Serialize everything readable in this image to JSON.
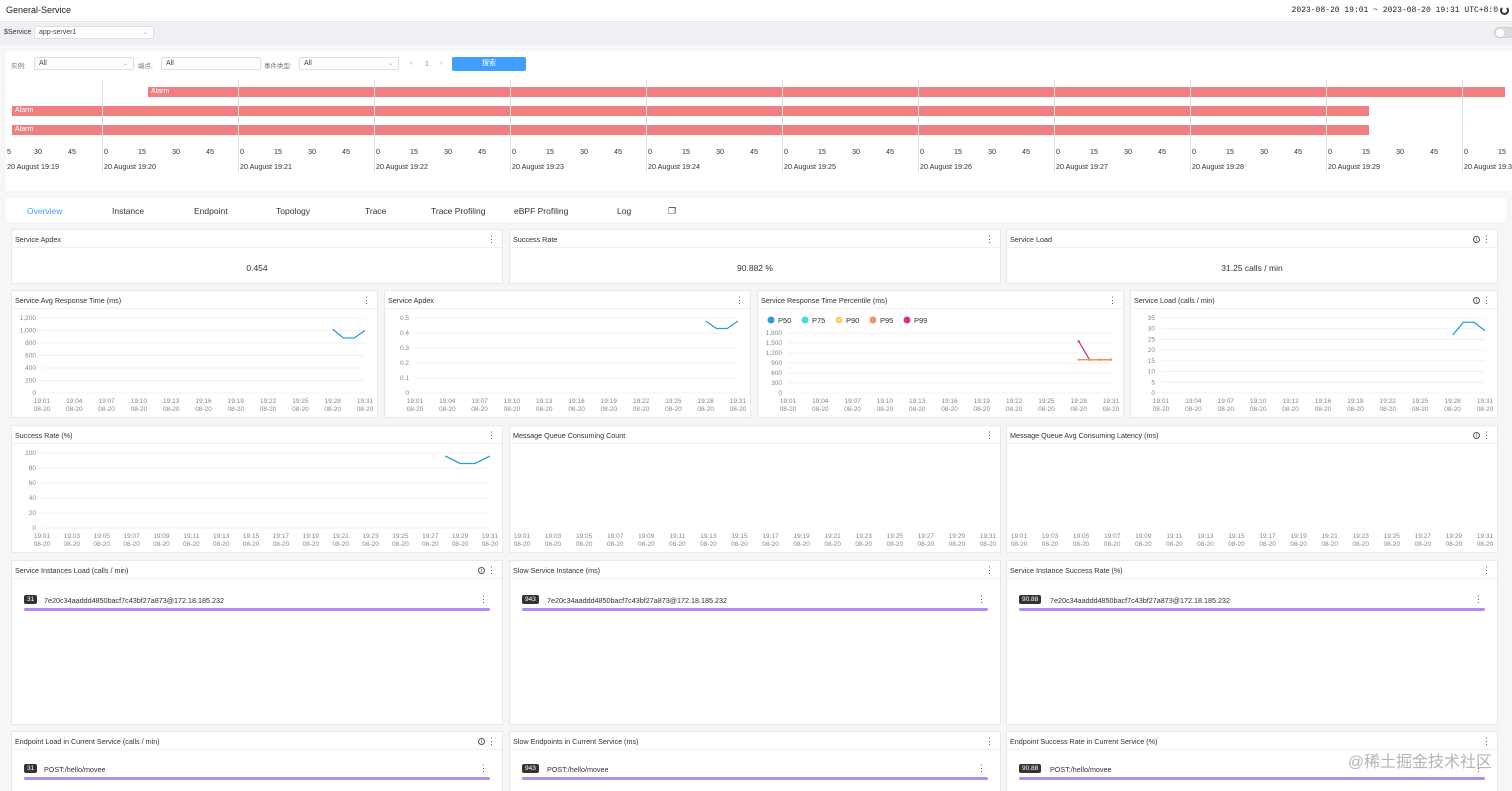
{
  "header": {
    "title": "General-Service",
    "time_range": "2023-08-20 19:01 ~ 2023-08-20 19:31",
    "timezone": "UTC+8:0"
  },
  "service_bar": {
    "label": "$Service",
    "value": "app-server1"
  },
  "filters": {
    "instance_label": "实例:",
    "instance_value": "All",
    "endpoint_label": "端点:",
    "endpoint_value": "All",
    "event_type_label": "事件类型:",
    "event_type_value": "All",
    "page": "1",
    "search_label": "搜索"
  },
  "timeline": {
    "alarms": [
      "Alarm",
      "Alarm",
      "Alarm"
    ],
    "minute_ticks": [
      "5",
      "30",
      "45",
      "0",
      "15",
      "30",
      "45",
      "0",
      "15",
      "30",
      "45",
      "0",
      "15",
      "30",
      "45",
      "0",
      "15",
      "30",
      "45",
      "0",
      "15",
      "30",
      "45",
      "0",
      "15",
      "30",
      "45",
      "0",
      "15",
      "30",
      "45",
      "0",
      "15",
      "30",
      "45",
      "0",
      "15",
      "30",
      "45",
      "0",
      "15",
      "30",
      "45",
      "0",
      "15"
    ],
    "day_labels": [
      "20 August 19:19",
      "20 August 19:20",
      "20 August 19:21",
      "20 August 19:22",
      "20 August 19:23",
      "20 August 19:24",
      "20 August 19:25",
      "20 August 19:26",
      "20 August 19:27",
      "20 August 19:28",
      "20 August 19:29",
      "20 August 19:3"
    ]
  },
  "tabs": [
    "Overview",
    "Instance",
    "Endpoint",
    "Topology",
    "Trace",
    "Trace Profiling",
    "eBPF Profiling",
    "Log"
  ],
  "cards": {
    "apdex_value": {
      "title": "Service Apdex",
      "value": "0.454"
    },
    "success_value": {
      "title": "Success Rate",
      "value": "90.882 %"
    },
    "load_value": {
      "title": "Service Load",
      "value": "31.25 calls / min"
    },
    "avg_resp": {
      "title": "Service Avg Response Time (ms)"
    },
    "apdex_chart": {
      "title": "Service Apdex"
    },
    "percentile": {
      "title": "Service Response Time Percentile (ms)"
    },
    "load_chart": {
      "title": "Service Load (calls / min)"
    },
    "success_chart": {
      "title": "Success Rate (%)"
    },
    "mq_count": {
      "title": "Message Queue Consuming Count"
    },
    "mq_latency": {
      "title": "Message Queue Avg Consuming Latency (ms)"
    },
    "inst_load": {
      "title": "Service Instances Load (calls / min)",
      "badge": "31",
      "text": "7e20c34aaddd4850bacf7c43bf27a873@172.18.185.232"
    },
    "slow_inst": {
      "title": "Slow Service Instance (ms)",
      "badge": "943",
      "text": "7e20c34aaddd4850bacf7c43bf27a873@172.18.185.232"
    },
    "inst_success": {
      "title": "Service Instance Success Rate (%)",
      "badge": "90.88",
      "text": "7e20c34aaddd4850bacf7c43bf27a873@172.18.185.232"
    },
    "ep_load": {
      "title": "Endpoint Load in Current Service (calls / min)",
      "badge": "31",
      "text": "POST:/hello/movee"
    },
    "slow_ep": {
      "title": "Slow Endpoints in Current Service (ms)",
      "badge": "943",
      "text": "POST:/hello/movee"
    },
    "ep_success": {
      "title": "Endpoint Success Rate in Current Service (%)",
      "badge": "90.88",
      "text": "POST:/hello/movee"
    }
  },
  "watermark": "@稀土掘金技术社区",
  "chart_data": [
    {
      "type": "line",
      "title": "Service Avg Response Time (ms)",
      "ylim": [
        0,
        1200
      ],
      "yticks": [
        "0",
        "200",
        "400",
        "600",
        "800",
        "1,000",
        "1,200"
      ],
      "x": [
        "19:01",
        "19:04",
        "19:07",
        "19:10",
        "19:13",
        "19:16",
        "19:19",
        "19:22",
        "19:25",
        "19:28",
        "19:31"
      ],
      "x_sub": "08-20",
      "series": [
        {
          "points": [
            [
              28,
              1020
            ],
            [
              29,
              880
            ],
            [
              30,
              880
            ],
            [
              31,
              1000
            ]
          ]
        }
      ],
      "color": "#2b9ed6"
    },
    {
      "type": "line",
      "title": "Service Apdex",
      "ylim": [
        0,
        0.5
      ],
      "yticks": [
        "0",
        "0.1",
        "0.2",
        "0.3",
        "0.4",
        "0.5"
      ],
      "x": [
        "19:01",
        "19:04",
        "19:07",
        "19:10",
        "19:13",
        "19:16",
        "19:19",
        "19:22",
        "19:25",
        "19:28",
        "19:31"
      ],
      "x_sub": "08-20",
      "series": [
        {
          "points": [
            [
              28,
              0.48
            ],
            [
              29,
              0.43
            ],
            [
              30,
              0.43
            ],
            [
              31,
              0.48
            ]
          ]
        }
      ],
      "color": "#2b9ed6"
    },
    {
      "type": "line",
      "title": "Service Response Time Percentile (ms)",
      "ylim": [
        0,
        1800
      ],
      "yticks": [
        "0",
        "300",
        "600",
        "900",
        "1,200",
        "1,500",
        "1,800"
      ],
      "x": [
        "19:01",
        "19:04",
        "19:07",
        "19:10",
        "19:13",
        "19:16",
        "19:19",
        "19:22",
        "19:25",
        "19:28",
        "19:31"
      ],
      "x_sub": "08-20",
      "legend": [
        "P50",
        "P75",
        "P90",
        "P95",
        "P99"
      ],
      "legend_colors": [
        "#2b9ed6",
        "#4fd6e0",
        "#f7d56a",
        "#f3935e",
        "#d6358c"
      ],
      "series": [
        {
          "name": "P99",
          "points": [
            [
              28,
              1550
            ],
            [
              29,
              1000
            ],
            [
              30,
              1000
            ],
            [
              31,
              1000
            ]
          ]
        },
        {
          "name": "P95",
          "points": [
            [
              28,
              1000
            ],
            [
              29,
              1000
            ],
            [
              30,
              1000
            ],
            [
              31,
              1000
            ]
          ]
        }
      ],
      "color": "#d6358c"
    },
    {
      "type": "line",
      "title": "Service Load (calls / min)",
      "ylim": [
        0,
        35
      ],
      "yticks": [
        "0",
        "5",
        "10",
        "15",
        "20",
        "25",
        "30",
        "35"
      ],
      "x": [
        "19:01",
        "19:04",
        "19:07",
        "19:10",
        "19:12",
        "19:16",
        "19:19",
        "19:22",
        "19:25",
        "19:28",
        "19:31"
      ],
      "x_sub": "08-20",
      "series": [
        {
          "points": [
            [
              28,
              27
            ],
            [
              29,
              33
            ],
            [
              30,
              33
            ],
            [
              31,
              29
            ]
          ]
        }
      ],
      "color": "#2b9ed6"
    },
    {
      "type": "line",
      "title": "Success Rate (%)",
      "ylim": [
        0,
        100
      ],
      "yticks": [
        "0",
        "20",
        "40",
        "60",
        "80",
        "100"
      ],
      "x": [
        "19:01",
        "19:03",
        "19:05",
        "19:07",
        "19:09",
        "19:11",
        "19:13",
        "19:15",
        "19:17",
        "19:19",
        "19:21",
        "19:23",
        "19:25",
        "19:27",
        "19:29",
        "19:31"
      ],
      "x_sub": "08-20",
      "series": [
        {
          "points": [
            [
              28,
              96
            ],
            [
              29,
              86
            ],
            [
              30,
              86
            ],
            [
              31,
              96
            ]
          ]
        }
      ],
      "color": "#2b9ed6"
    },
    {
      "type": "line",
      "title": "Message Queue Consuming Count",
      "x": [
        "19:01",
        "19:03",
        "19:05",
        "19:07",
        "19:09",
        "19:11",
        "19:13",
        "19:15",
        "19:17",
        "19:19",
        "19:21",
        "19:23",
        "19:25",
        "19:27",
        "19:29",
        "19:31"
      ],
      "x_sub": "08-20",
      "series": []
    },
    {
      "type": "line",
      "title": "Message Queue Avg Consuming Latency (ms)",
      "x": [
        "19:01",
        "19:03",
        "19:05",
        "19:07",
        "19:09",
        "19:11",
        "19:13",
        "19:15",
        "19:17",
        "19:19",
        "19:21",
        "19:23",
        "19:25",
        "19:27",
        "19:29",
        "19:31"
      ],
      "x_sub": "08-20",
      "series": []
    }
  ]
}
